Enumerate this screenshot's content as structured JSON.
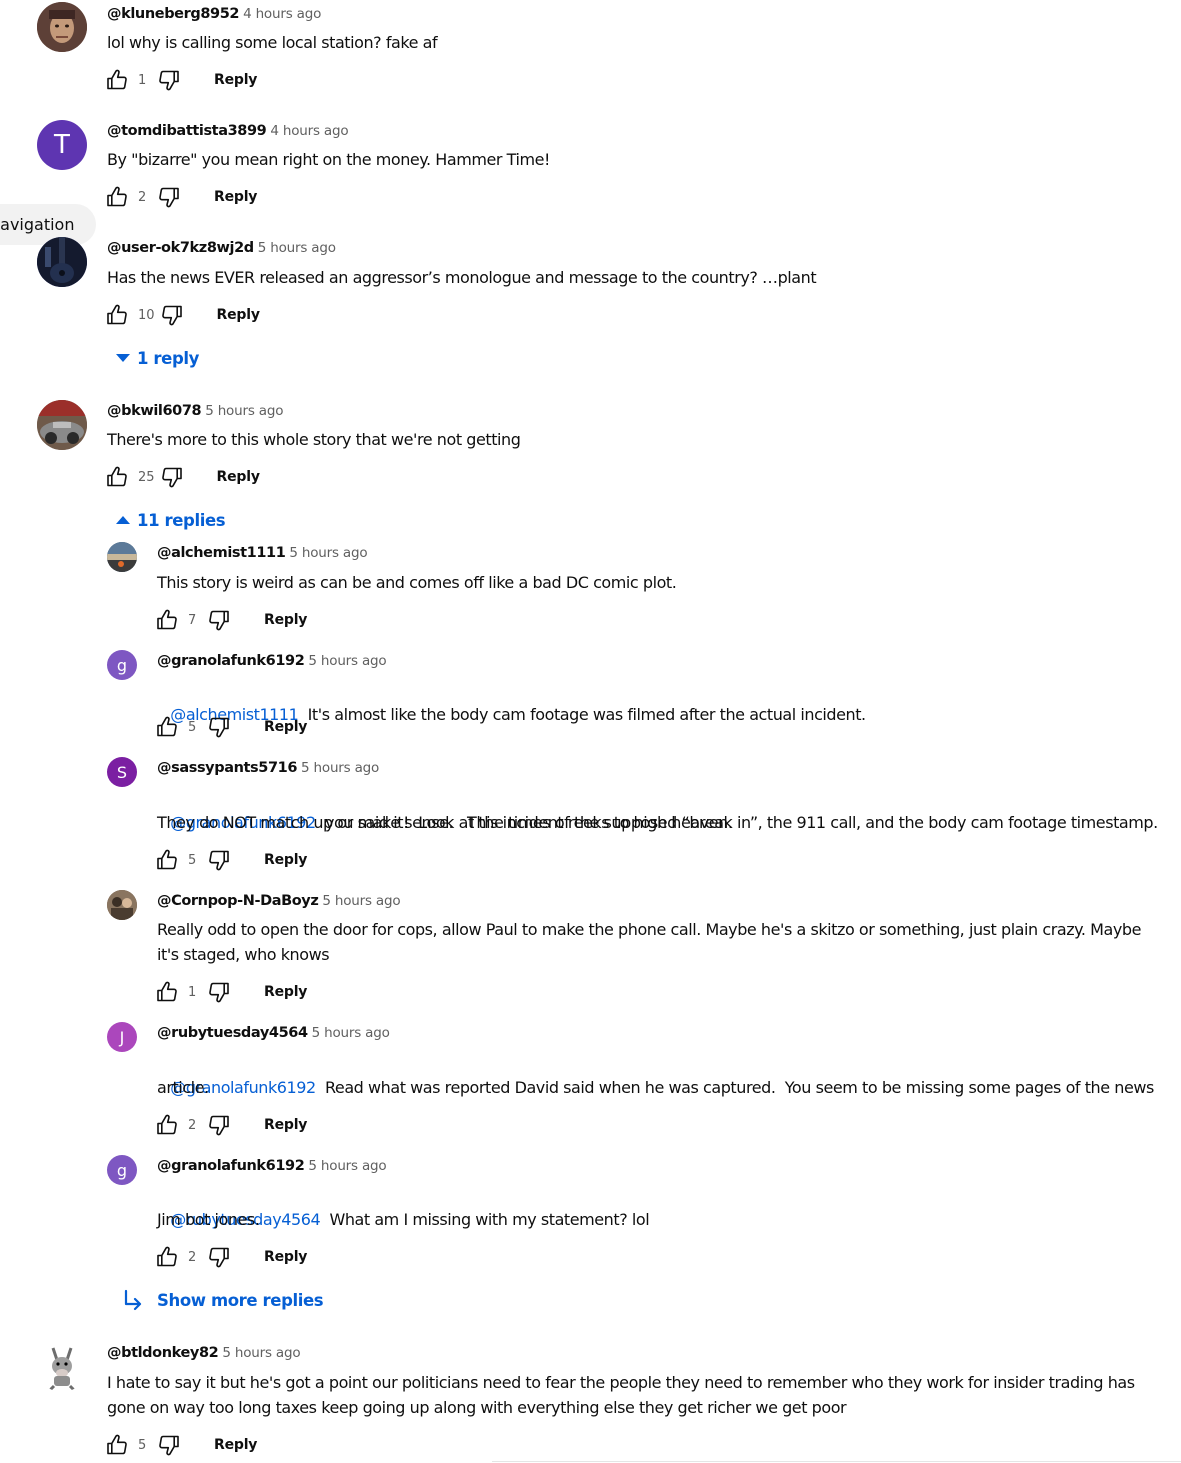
{
  "colors": {
    "link": "#065fd4",
    "meta": "#606060",
    "text": "#0f0f0f"
  },
  "nav_pill": {
    "label": "navigation"
  },
  "comments": [
    {
      "author": "@kluneberg8952",
      "time": "4 hours ago",
      "text": "lol why is calling some local station? fake af",
      "likes": "1",
      "reply_label": "Reply",
      "avatar": {
        "type": "photo",
        "icon": "face-photo-icon"
      }
    },
    {
      "author": "@tomdibattista3899",
      "time": "4 hours ago",
      "text": "By \"bizarre\" you mean right on the money. Hammer Time!",
      "likes": "2",
      "reply_label": "Reply",
      "avatar": {
        "type": "letter",
        "letter": "T",
        "color": "#5e35b1"
      }
    },
    {
      "author": "@user-ok7kz8wj2d",
      "time": "5 hours ago",
      "text": "Has the news EVER released an aggressor’s monologue and message to the country? …plant",
      "likes": "10",
      "reply_label": "Reply",
      "replies_toggle": "1 reply",
      "avatar": {
        "type": "photo",
        "icon": "guitar-photo-icon"
      }
    },
    {
      "author": "@bkwil6078",
      "time": "5 hours ago",
      "text": "There's more to this whole story that we're not getting",
      "likes": "25",
      "reply_label": "Reply",
      "replies_toggle": "11 replies",
      "avatar": {
        "type": "photo",
        "icon": "car-photo-icon"
      }
    }
  ],
  "replies": [
    {
      "author": "@alchemist1111",
      "time": "5 hours ago",
      "mention": "",
      "text": "This story is weird as can be and comes off like a bad DC comic plot.",
      "likes": "7",
      "reply_label": "Reply",
      "avatar": {
        "type": "photo",
        "icon": "landscape-photo-icon"
      }
    },
    {
      "author": "@granolafunk6192",
      "time": "5 hours ago",
      "mention": "@alchemist1111",
      "text": "It's almost like the body cam footage was filmed after the actual incident.",
      "likes": "5",
      "reply_label": "Reply",
      "avatar": {
        "type": "letter",
        "letter": "g",
        "color": "#7e57c2"
      }
    },
    {
      "author": "@sassypants5716",
      "time": "5 hours ago",
      "mention": "@granolafunk6192",
      "text": " you said it!  Look at the times of the supposed “break in”, the 911 call, and the body cam footage timestamp.",
      "text2": "They do NOT match up or make sense.   This incident reeks to high heaven.",
      "likes": "5",
      "reply_label": "Reply",
      "avatar": {
        "type": "letter",
        "letter": "S",
        "color": "#7b1fa2"
      }
    },
    {
      "author": "@Cornpop-N-DaBoyz",
      "time": "5 hours ago",
      "mention": "",
      "text": "Really odd to open the door for cops, allow Paul to make the phone call. Maybe he's a skitzo or something, just plain crazy. Maybe",
      "text2": "it's staged, who knows",
      "likes": "1",
      "reply_label": "Reply",
      "avatar": {
        "type": "photo",
        "icon": "people-photo-icon"
      }
    },
    {
      "author": "@rubytuesday4564",
      "time": "5 hours ago",
      "mention": "@granolafunk6192",
      "text": "Read what was reported David said when he was captured.  You seem to be missing some pages of the news",
      "text2": "article.",
      "likes": "2",
      "reply_label": "Reply",
      "avatar": {
        "type": "letter",
        "letter": "J",
        "color": "#ab47bc"
      }
    },
    {
      "author": "@granolafunk6192",
      "time": "5 hours ago",
      "mention": "@rubytuesday4564",
      "text": "What am I missing with my statement? lol",
      "text2": "Jim bot jones.",
      "likes": "2",
      "reply_label": "Reply",
      "avatar": {
        "type": "letter",
        "letter": "g",
        "color": "#7e57c2"
      }
    }
  ],
  "show_more": {
    "label": "Show more replies"
  },
  "last_comment": {
    "author": "@btldonkey82",
    "time": "5 hours ago",
    "text": "I hate to say it but he's got a point our politicians need to fear the people they need to remember who they work for insider trading has",
    "text2": "gone on way too long taxes keep going up along with everything else they get richer we get poor",
    "likes": "5",
    "reply_label": "Reply",
    "avatar": {
      "type": "photo",
      "icon": "donkey-cartoon-icon"
    }
  }
}
